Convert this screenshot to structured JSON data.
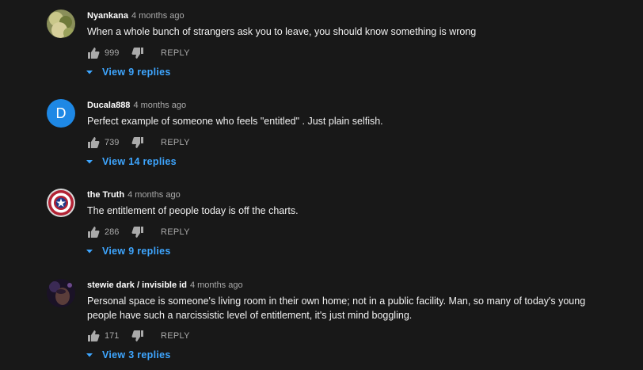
{
  "comments": [
    {
      "author": "Nyankana",
      "time": "4 months ago",
      "text": "When a whole bunch of strangers ask you to leave, you should know something is wrong",
      "likes": "999",
      "reply_label": "REPLY",
      "view_replies": "View 9 replies",
      "avatar": "photo-avatar-nature"
    },
    {
      "author": "Ducala888",
      "time": "4 months ago",
      "text": "Perfect example of someone who feels \"entitled\" . Just plain selfish.",
      "likes": "739",
      "reply_label": "REPLY",
      "view_replies": "View 14 replies",
      "avatar": "letter-avatar",
      "avatar_letter": "D",
      "avatar_color": "#1e88e5"
    },
    {
      "author": "the Truth",
      "time": "4 months ago",
      "text": "The entitlement of people today is off the charts.",
      "likes": "286",
      "reply_label": "REPLY",
      "view_replies": "View 9 replies",
      "avatar": "shield-avatar"
    },
    {
      "author": "stewie dark / invisible id",
      "time": "4 months ago",
      "text": "Personal space is someone's living room in their own home; not in a public facility. Man, so many of today's young people have such a narcissistic level of entitlement, it's just mind boggling.",
      "likes": "171",
      "reply_label": "REPLY",
      "view_replies": "View 3 replies",
      "avatar": "photo-avatar-dark"
    }
  ],
  "colors": {
    "background": "#181818",
    "link": "#3ea6ff",
    "muted": "#aaaaaa"
  },
  "icons": [
    "thumb-up-icon",
    "thumb-down-icon",
    "caret-down-icon"
  ]
}
